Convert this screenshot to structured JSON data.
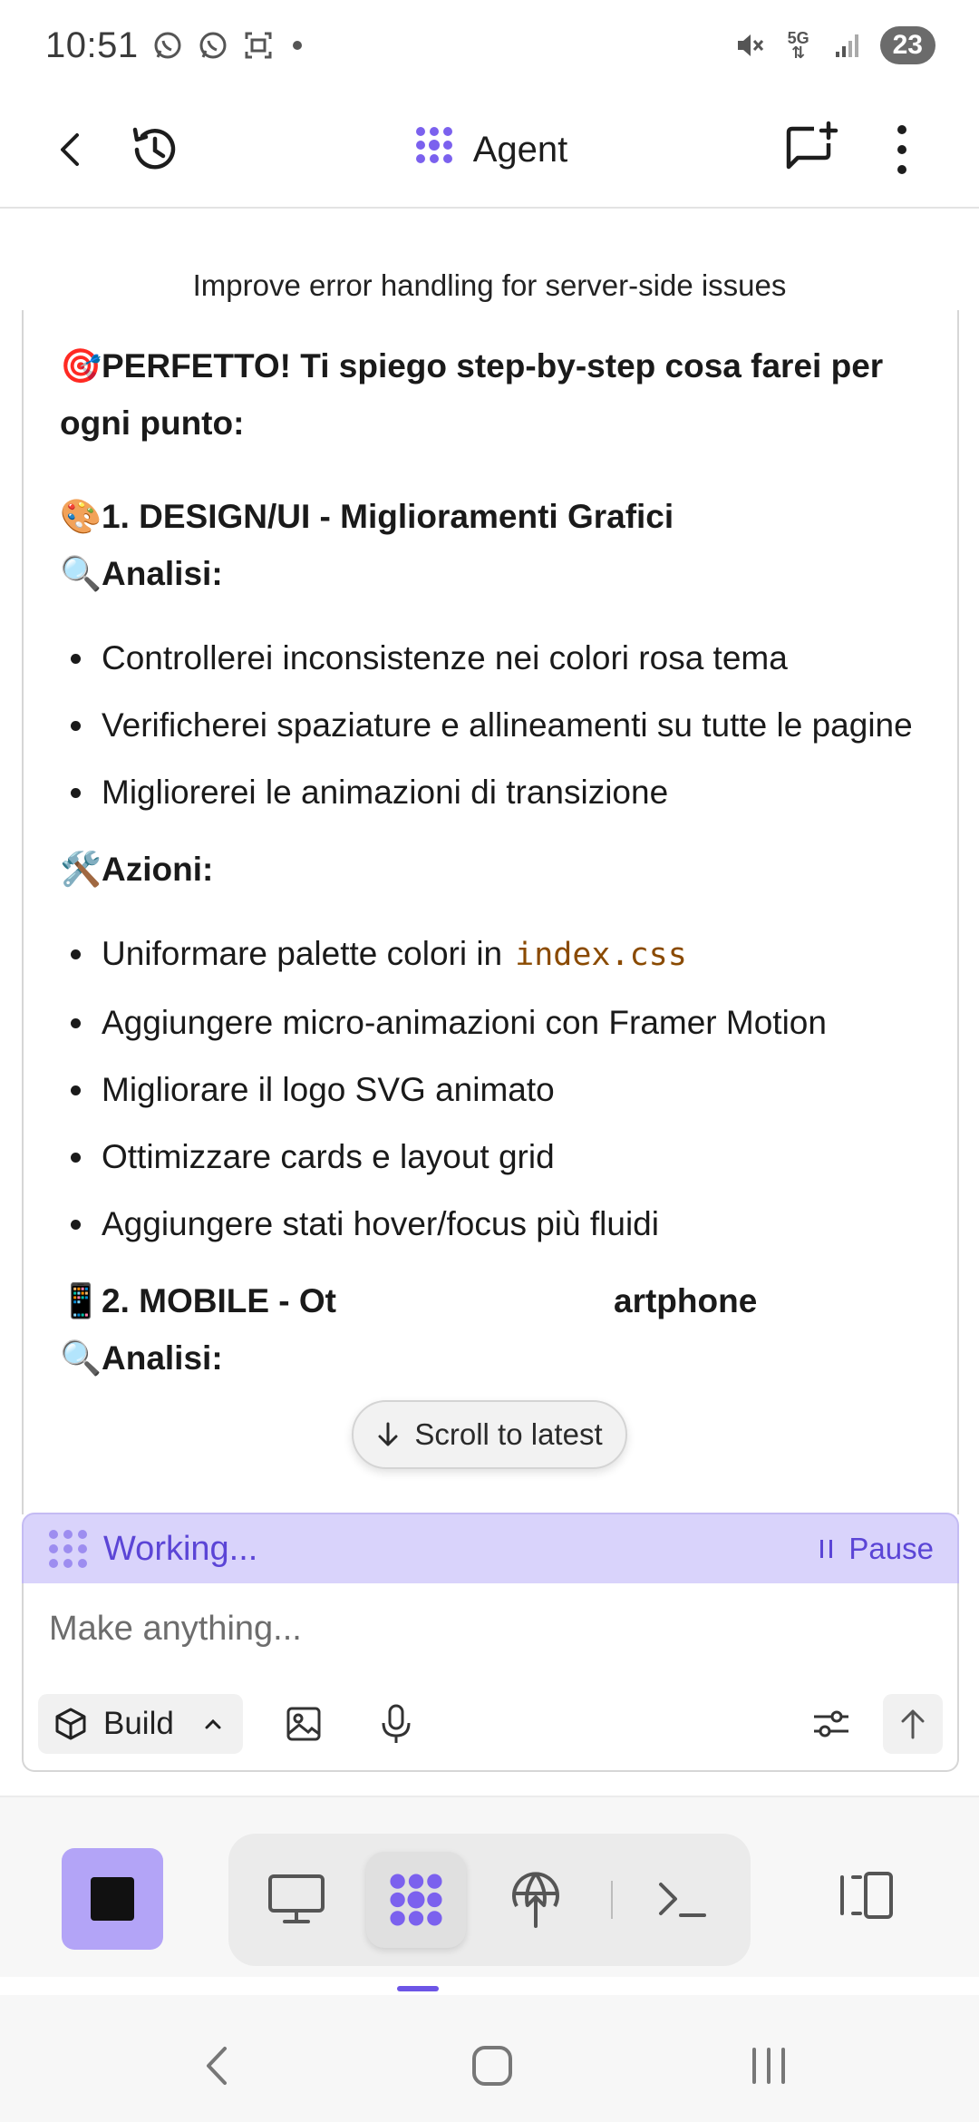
{
  "status_bar": {
    "time": "10:51",
    "icons_left": [
      "whatsapp-icon",
      "whatsapp-icon",
      "screenshot-icon",
      "dot-icon"
    ],
    "icons_right": [
      "mute-icon",
      "5g-icon",
      "signal-icon"
    ],
    "network": "5G",
    "battery": "23"
  },
  "header": {
    "title": "Agent",
    "back_icon": "back-arrow-icon",
    "history_icon": "history-icon",
    "new_chat_icon": "new-chat-icon",
    "menu_icon": "more-vert-icon"
  },
  "conversation": {
    "topic": "Improve error handling for server-side issues",
    "intro": {
      "emoji": "🎯",
      "text": "PERFETTO! Ti spiego step-by-step cosa farei per ogni punto:"
    },
    "section1": {
      "heading": {
        "emoji": "🎨",
        "text": "1. DESIGN/UI - Miglioramenti Grafici"
      },
      "analysis": {
        "emoji": "🔍",
        "text": "Analisi:"
      },
      "analysis_items": [
        "Controllerei inconsistenze nei colori rosa tema",
        "Verificherei spaziature e allineamenti su tutte le pagine",
        "Migliorerei le animazioni di transizione"
      ],
      "actions": {
        "emoji": "🛠️",
        "text": "Azioni:"
      },
      "action_items": [
        {
          "text": "Uniformare palette colori in",
          "code": "index.css"
        },
        {
          "text": "Aggiungere micro-animazioni con Framer Motion"
        },
        {
          "text": "Migliorare il logo SVG animato"
        },
        {
          "text": "Ottimizzare cards e layout grid"
        },
        {
          "text": "Aggiungere stati hover/focus più fluidi"
        }
      ]
    },
    "section2": {
      "heading": {
        "emoji": "📱",
        "text": "2. MOBILE - Ot",
        "text_tail": "artphone"
      },
      "analysis": {
        "emoji": "🔍",
        "text": "Analisi:"
      }
    },
    "scroll_to_latest": "Scroll to latest"
  },
  "working": {
    "status": "Working...",
    "pause_label": "Pause"
  },
  "composer": {
    "placeholder": "Make anything...",
    "mode_label": "Build"
  },
  "colors": {
    "accent": "#6c55e6",
    "working_bg": "#d9d3fb",
    "stop_bg": "#b3a4f7",
    "code_color": "#8a4a00"
  }
}
